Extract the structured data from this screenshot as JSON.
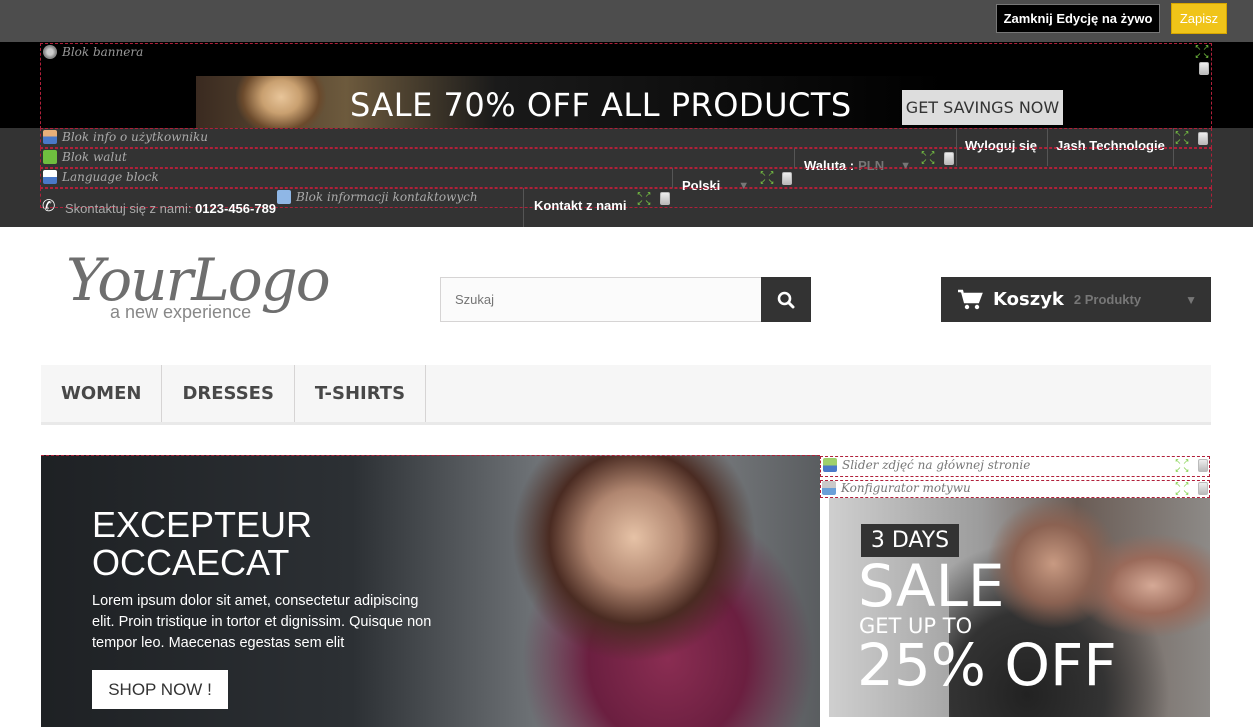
{
  "live_edit": {
    "close_label": "Zamknij Edycję na żywo",
    "save_label": "Zapisz"
  },
  "blocks": {
    "banner": "Blok bannera",
    "user_info": "Blok info o użytkowniku",
    "currency": "Blok walut",
    "language": "Language block",
    "contact_info": "Blok informacji kontaktowych",
    "home_slider": "Slider zdjęć na głównej stronie",
    "theme_config": "Konfigurator motywu"
  },
  "banner": {
    "text": "SALE 70% OFF ALL PRODUCTS",
    "cta": "GET SAVINGS NOW"
  },
  "nav": {
    "logout": "Wyloguj się",
    "user_name": "Jash Technologie",
    "currency_label": "Waluta :",
    "currency_value": "PLN",
    "language_value": "Polski",
    "contact_link": "Kontakt z nami",
    "call_text": "Skontaktuj się z nami:",
    "phone": "0123-456-789"
  },
  "logo": {
    "main": "YourLogo",
    "tagline": "a new experience"
  },
  "search": {
    "placeholder": "Szukaj"
  },
  "cart": {
    "label": "Koszyk",
    "count": "2 Produkty"
  },
  "menu": {
    "items": [
      "WOMEN",
      "DRESSES",
      "T-SHIRTS"
    ]
  },
  "slider": {
    "title": "EXCEPTEUR OCCAECAT",
    "text": "Lorem ipsum dolor sit amet, consectetur adipiscing elit. Proin tristique in tortor et dignissim. Quisque non tempor leo. Maecenas egestas sem elit",
    "button": "SHOP NOW !"
  },
  "promo": {
    "days": "3 DAYS",
    "sale": "SALE",
    "get_up_to": "GET UP TO",
    "off": "25% OFF"
  },
  "colors": {
    "accent": "#f0c419",
    "dark": "#333333",
    "block_border": "#b0203a",
    "move_icon": "#7dcf44"
  }
}
